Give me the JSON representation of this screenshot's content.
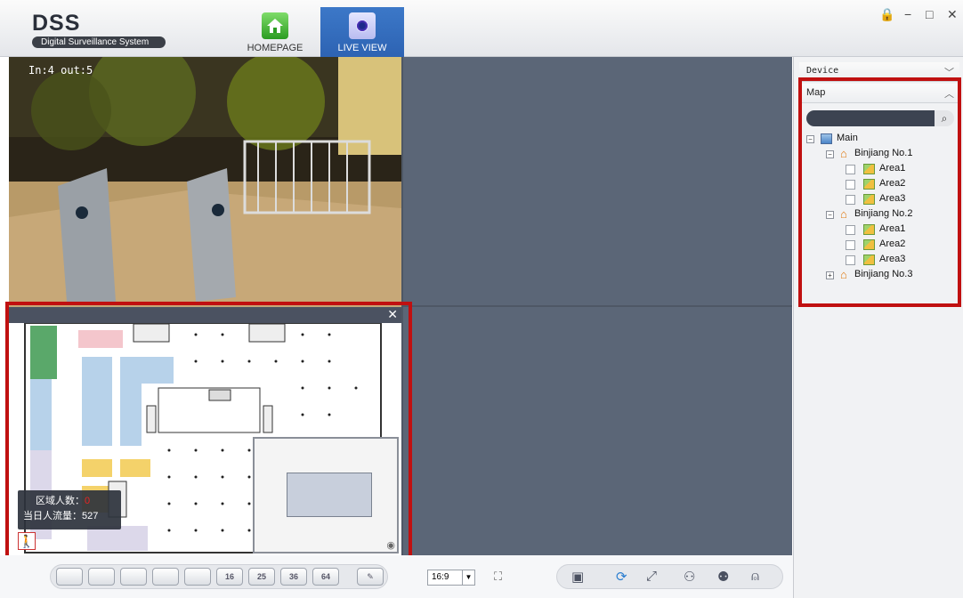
{
  "app": {
    "title": "DSS",
    "subtitle": "Digital Surveillance System"
  },
  "nav": {
    "home_label": "HOMEPAGE",
    "live_label": "LIVE VIEW"
  },
  "window_controls": {
    "lock": "🔒",
    "minimize": "−",
    "maximize": "□",
    "close": "✕"
  },
  "camera": {
    "counter": "In:4  out:5"
  },
  "map_popup": {
    "close": "✕",
    "area_count_label": "区域人数：",
    "area_count_value": "0",
    "daily_flow_label": "当日人流量：",
    "daily_flow_value": "527",
    "exit_icon": "🚶"
  },
  "panel": {
    "device_label": "Device",
    "map_label": "Map",
    "search_placeholder": "",
    "tree": {
      "root": "Main",
      "groups": [
        {
          "name": "Binjiang No.1",
          "expanded": true,
          "areas": [
            "Area1",
            "Area2",
            "Area3"
          ]
        },
        {
          "name": "Binjiang No.2",
          "expanded": true,
          "areas": [
            "Area1",
            "Area2",
            "Area3"
          ]
        },
        {
          "name": "Binjiang No.3",
          "expanded": false,
          "areas": []
        }
      ]
    }
  },
  "toolbar": {
    "layouts": [
      "",
      "",
      "",
      "",
      "",
      "16",
      "25",
      "36",
      "64"
    ],
    "ratio": "16:9",
    "accent": "#2d63b3",
    "highlight": "#c01010"
  }
}
